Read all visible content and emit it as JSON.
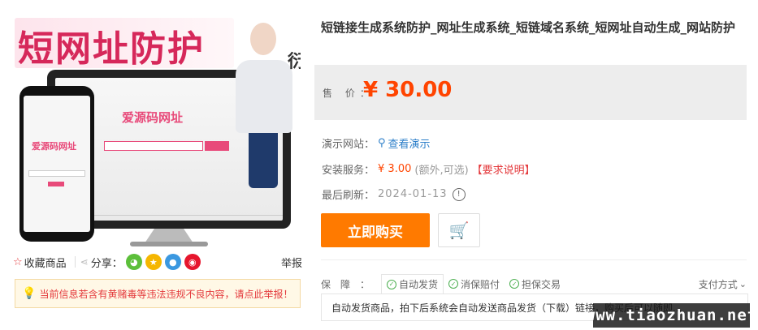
{
  "gallery": {
    "banner_title": "短网址防护",
    "side_char": "衍",
    "monitor_brand": "爱源码网址",
    "phone_brand": "爱源码网址"
  },
  "actions": {
    "favorite_label": "收藏商品",
    "share_label": "分享：",
    "report_label": "举报"
  },
  "notice": {
    "text": "当前信息若含有黄赌毒等违法违规不良内容，请点此举报！"
  },
  "product": {
    "title": "短链接生成系统防护_网址生成系统_短链域名系统_短网址自动生成_网站防护",
    "price_label": "售 价：",
    "price": "¥ 30.00",
    "demo_key": "演示网站：",
    "demo_link": "查看演示",
    "service_key": "安装服务：",
    "service_price": "¥ 3.00",
    "service_note": "(额外,可选)",
    "service_req": "【要求说明】",
    "refresh_key": "最后刷新：",
    "refresh_date": "2024-01-13"
  },
  "buttons": {
    "buy": "立即购买"
  },
  "guarantee": {
    "key": "保障：",
    "tags": [
      "自动发货",
      "消保赔付",
      "担保交易"
    ],
    "pay_label": "支付方式",
    "description": "自动发货商品，拍下后系统会自动发送商品发货（下载）链接，购买后可以随即..."
  },
  "watermark": "www.tiaozhuan.net",
  "colors": {
    "price": "#ff4400",
    "buy_button": "#ff7a00",
    "link": "#2d7fc9",
    "warning": "#e4393c"
  },
  "icons": {
    "favorite": "star-icon",
    "share": "share-icon",
    "demo": "search-icon",
    "refresh": "clock-icon",
    "cart": "cart-icon",
    "guarantee": "check-circle-icon",
    "pay": "chevron-down-icon",
    "notice": "lightbulb-icon"
  }
}
